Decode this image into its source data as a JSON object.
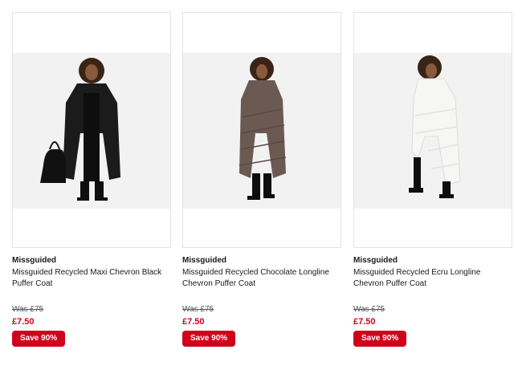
{
  "products": [
    {
      "brand": "Missguided",
      "title": "Missguided Recycled Maxi Chevron Black Puffer Coat",
      "was_price": "Was £75",
      "price": "£7.50",
      "save_badge": "Save 90%",
      "coat_color": "#1b1b1b"
    },
    {
      "brand": "Missguided",
      "title": "Missguided Recycled Chocolate Longline Chevron Puffer Coat",
      "was_price": "Was £75",
      "price": "£7.50",
      "save_badge": "Save 90%",
      "coat_color": "#6b5a52"
    },
    {
      "brand": "Missguided",
      "title": "Missguided Recycled Ecru Longline Chevron Puffer Coat",
      "was_price": "Was £75",
      "price": "£7.50",
      "save_badge": "Save 90%",
      "coat_color": "#f6f6f4"
    }
  ],
  "colors": {
    "sale_red": "#d0021b",
    "photo_bg": "#f2f2f2",
    "card_border": "#e3e3e3"
  }
}
